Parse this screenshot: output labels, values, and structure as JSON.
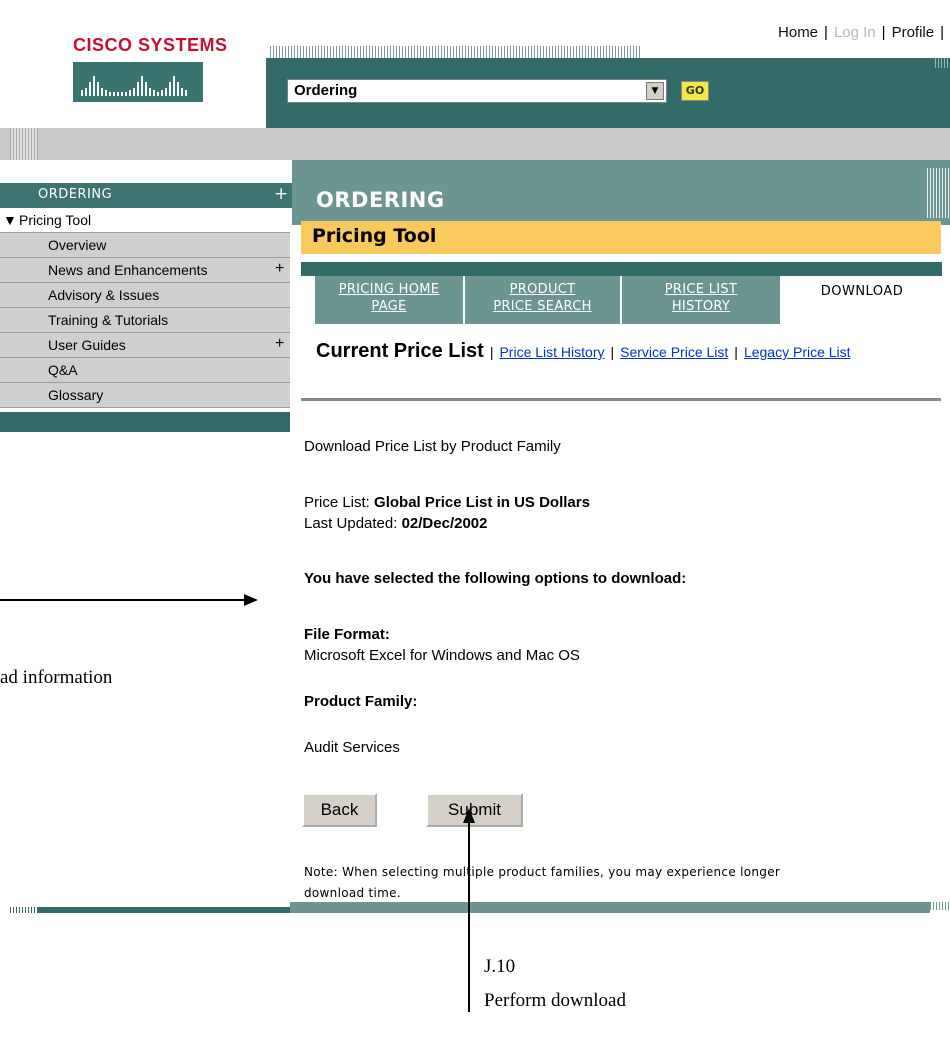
{
  "brand": {
    "name": "CISCO SYSTEMS"
  },
  "top_links": {
    "home": "Home",
    "login": "Log In",
    "profile": "Profile",
    "sep": "|"
  },
  "header": {
    "select_value": "Ordering",
    "go_label": "GO"
  },
  "nav": {
    "heading": "ORDERING",
    "heading_plus": "+",
    "items": [
      {
        "label": "Pricing Tool",
        "expanded": true
      },
      {
        "label": "Overview"
      },
      {
        "label": "News and Enhancements",
        "plus": "+"
      },
      {
        "label": "Advisory & Issues"
      },
      {
        "label": "Training & Tutorials"
      },
      {
        "label": "User Guides",
        "plus": "+"
      },
      {
        "label": "Q&A"
      },
      {
        "label": "Glossary"
      }
    ]
  },
  "main": {
    "title": "ORDERING",
    "section": "Pricing Tool",
    "tabs": [
      {
        "label_1": "PRICING HOME",
        "label_2": "PAGE"
      },
      {
        "label_1": "PRODUCT",
        "label_2": "PRICE SEARCH"
      },
      {
        "label_1": "PRICE LIST",
        "label_2": "HISTORY"
      },
      {
        "label_1": "DOWNLOAD"
      }
    ],
    "price_links": {
      "current": "Current Price List",
      "history": "Price List History",
      "service": "Service Price List",
      "legacy_1": "Legacy",
      "legacy_2": "Price List",
      "sep": "|"
    },
    "download_heading": "Download Price List by Product Family",
    "price_list_label": "Price List:",
    "price_list_value": "Global Price List in US Dollars",
    "updated_label": "Last Updated:",
    "updated_value": "02/Dec/2002",
    "selected_heading": "You have selected the following options to download:",
    "file_format_label": "File Format:",
    "file_format_value": "Microsoft Excel for Windows and Mac OS",
    "product_family_label": "Product Family:",
    "product_family_value": "Audit Services",
    "back_label": "Back",
    "submit_label": "Submit",
    "note_1": "Note: When selecting multiple product families, you may experience longer",
    "note_2": "download time."
  },
  "annotations": {
    "left_text": "ad information",
    "step": "J.10",
    "step_text": "Perform download"
  },
  "colors": {
    "teal_dark": "#336a6a",
    "teal_mid": "#6c9592",
    "yellow": "#f9c95b",
    "link": "#0033cc",
    "logo_red": "#c8102e"
  }
}
